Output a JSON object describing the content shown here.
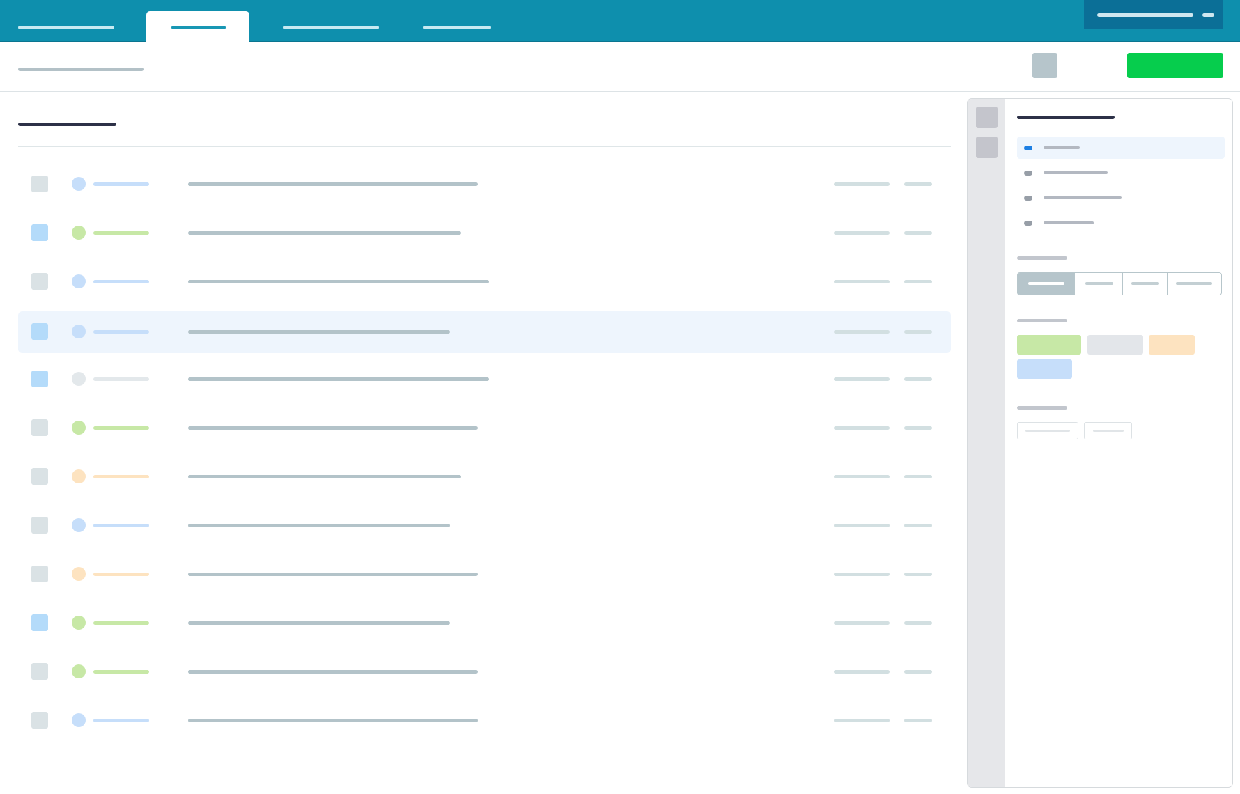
{
  "colors": {
    "nav_bg": "#0e8fad",
    "account_bg": "#0b6f97",
    "primary_button": "#06cd4d",
    "selected_row_bg": "#eef5fd",
    "status_blue": "#c6defa",
    "status_green": "#c7e8a6",
    "status_orange": "#fde3c0",
    "status_gray": "#e3e8eb",
    "checkbox_checked": "#b4dbfa",
    "checkbox_unchecked": "#dae2e5"
  },
  "nav": {
    "tabs": [
      {
        "active": false
      },
      {
        "active": true
      },
      {
        "active": false
      },
      {
        "active": false
      }
    ]
  },
  "toolbar": {
    "icon_button": "settings-icon",
    "primary_button_color": "#06cd4d"
  },
  "list": {
    "rows": [
      {
        "checked": false,
        "status": "blue",
        "selected": false
      },
      {
        "checked": true,
        "status": "green",
        "selected": false
      },
      {
        "checked": false,
        "status": "blue",
        "selected": false
      },
      {
        "checked": true,
        "status": "blue",
        "selected": true
      },
      {
        "checked": true,
        "status": "gray",
        "selected": false
      },
      {
        "checked": false,
        "status": "green",
        "selected": false
      },
      {
        "checked": false,
        "status": "orange",
        "selected": false
      },
      {
        "checked": false,
        "status": "blue",
        "selected": false
      },
      {
        "checked": false,
        "status": "orange",
        "selected": false
      },
      {
        "checked": true,
        "status": "green",
        "selected": false
      },
      {
        "checked": false,
        "status": "green",
        "selected": false
      },
      {
        "checked": false,
        "status": "blue",
        "selected": false
      }
    ]
  },
  "panel": {
    "rail_icons": [
      "panel-icon-1",
      "panel-icon-2"
    ],
    "menu": [
      {
        "active": true
      },
      {
        "active": false
      },
      {
        "active": false
      },
      {
        "active": false
      }
    ],
    "segmented": [
      {
        "active": true
      },
      {
        "active": false
      },
      {
        "active": false
      },
      {
        "active": false
      }
    ],
    "chips": [
      {
        "color": "#c7e8a6"
      },
      {
        "color": "#e3e6ea"
      },
      {
        "color": "#fde3c0"
      },
      {
        "color": "#c6defa"
      }
    ]
  }
}
